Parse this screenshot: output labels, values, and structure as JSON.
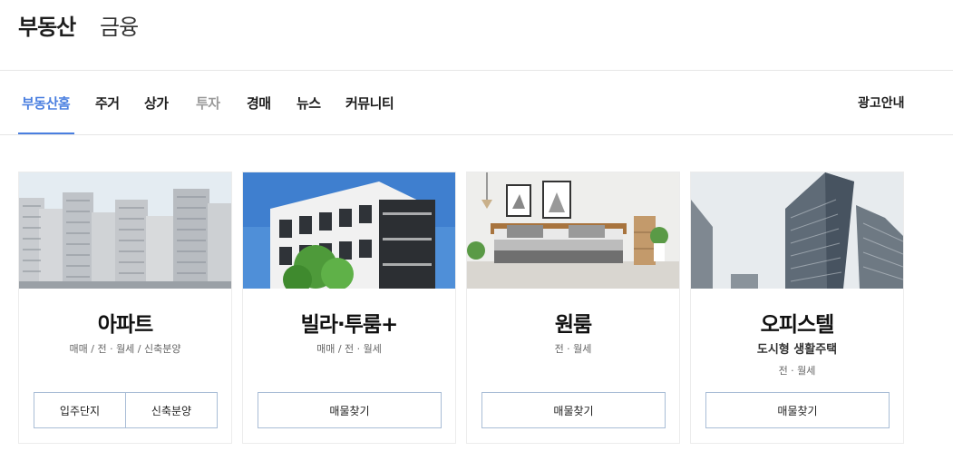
{
  "header": {
    "brand": "부동산",
    "secondary": "금융"
  },
  "nav": {
    "items": [
      {
        "label": "부동산홈"
      },
      {
        "label": "주거"
      },
      {
        "label": "상가"
      },
      {
        "label": "투자"
      },
      {
        "label": "경매"
      },
      {
        "label": "뉴스"
      },
      {
        "label": "커뮤니티"
      }
    ],
    "right": "광고안내"
  },
  "cards": [
    {
      "title": "아파트",
      "deal": "매매 / 전 · 월세 / 신축분양",
      "buttons": [
        "입주단지",
        "신축분양"
      ]
    },
    {
      "title": "빌라·투룸+",
      "deal": "매매 / 전 · 월세",
      "buttons": [
        "매물찾기"
      ]
    },
    {
      "title": "원룸",
      "deal": "전 · 월세",
      "buttons": [
        "매물찾기"
      ]
    },
    {
      "title": "오피스텔",
      "subtitle": "도시형 생활주택",
      "deal": "전 · 월세",
      "buttons": [
        "매물찾기"
      ]
    }
  ]
}
